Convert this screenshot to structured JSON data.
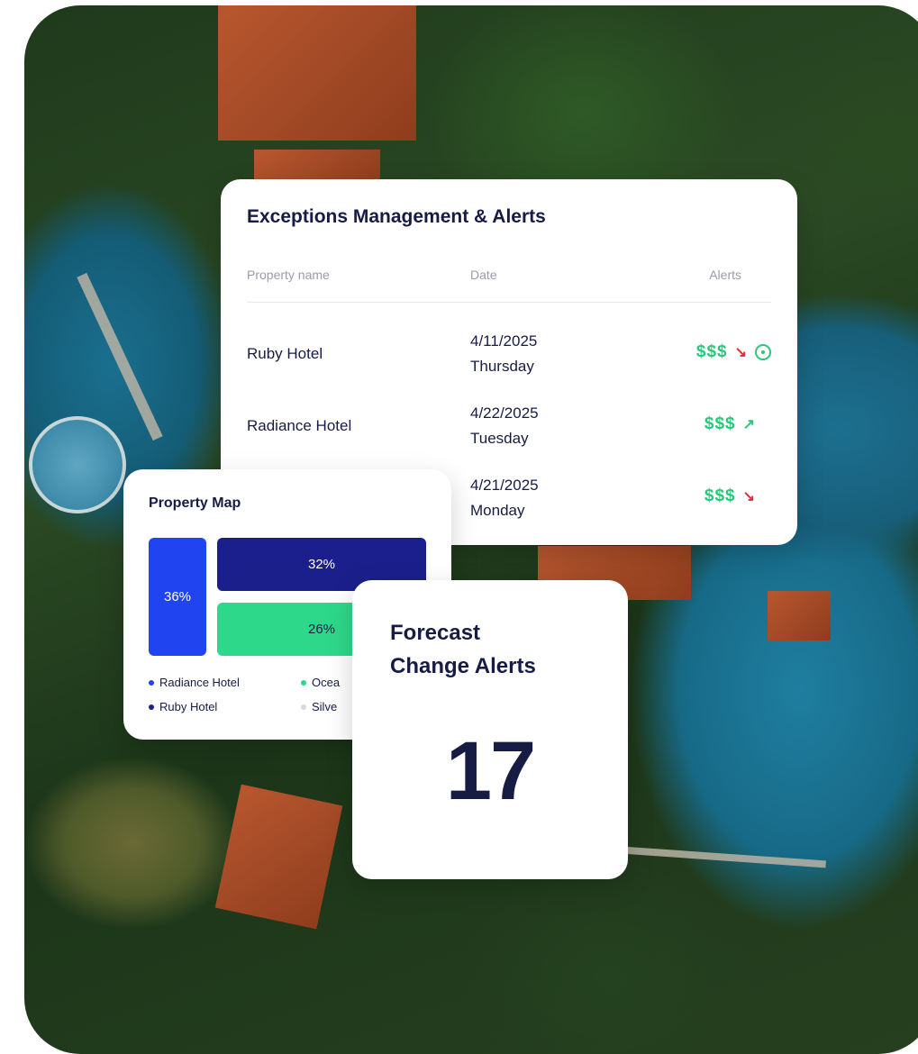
{
  "exceptions": {
    "title": "Exceptions Management & Alerts",
    "columns": {
      "property": "Property name",
      "date": "Date",
      "alerts": "Alerts"
    },
    "rows": [
      {
        "property": "Ruby Hotel",
        "date": "4/11/2025",
        "day": "Thursday",
        "money": "$$$",
        "trend": "down",
        "trend_icon": "trending-down-icon",
        "extra_icon": "tag-icon"
      },
      {
        "property": "Radiance Hotel",
        "date": "4/22/2025",
        "day": "Tuesday",
        "money": "$$$",
        "trend": "up",
        "trend_icon": "trending-up-icon"
      },
      {
        "property": "",
        "date": "4/21/2025",
        "day": "Monday",
        "money": "$$$",
        "trend": "down",
        "trend_icon": "trending-down-icon"
      }
    ],
    "colors": {
      "money": "#29c77a",
      "down": "#e5273c",
      "up": "#29c77a"
    }
  },
  "property_map": {
    "title": "Property Map",
    "blocks": [
      {
        "label": "36%",
        "value": 36,
        "color": "#1f44f0"
      },
      {
        "label": "32%",
        "value": 32,
        "color": "#1a1f8c"
      },
      {
        "label": "26%",
        "value": 26,
        "color": "#2ed88a"
      }
    ],
    "legend": [
      {
        "label": "Radiance Hotel",
        "color": "#1f44f0"
      },
      {
        "label": "Ocea",
        "color": "#2ed88a"
      },
      {
        "label": "Ruby Hotel",
        "color": "#1a1f8c"
      },
      {
        "label": "Silve",
        "color": "#d9d9de"
      }
    ]
  },
  "forecast": {
    "title_line1": "Forecast",
    "title_line2": "Change Alerts",
    "count": "17"
  }
}
